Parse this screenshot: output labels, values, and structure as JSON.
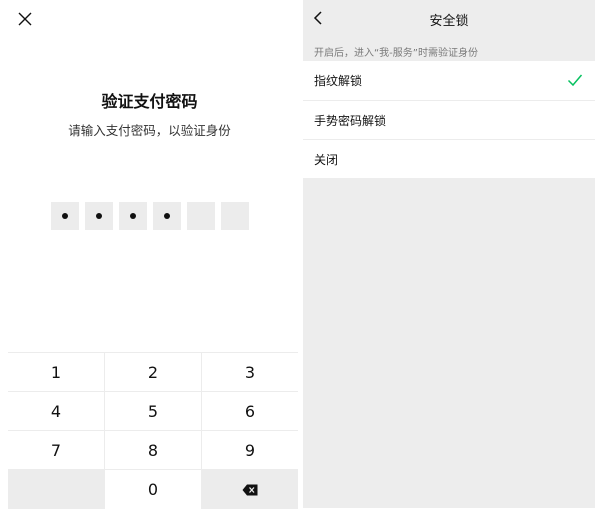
{
  "left": {
    "title": "验证支付密码",
    "subtitle": "请输入支付密码，以验证身份",
    "pin": {
      "length": 6,
      "filled_count": 4
    },
    "keypad": {
      "keys": [
        "1",
        "2",
        "3",
        "4",
        "5",
        "6",
        "7",
        "8",
        "9",
        "",
        "0",
        "backspace"
      ]
    },
    "icons": {
      "close": "close-icon",
      "backspace": "backspace-icon"
    }
  },
  "right": {
    "nav_title": "安全锁",
    "section_hint": "开启后，进入“我-服务”时需验证身份",
    "options": [
      {
        "label": "指纹解锁",
        "selected": true
      },
      {
        "label": "手势密码解锁",
        "selected": false
      },
      {
        "label": "关闭",
        "selected": false
      }
    ],
    "icons": {
      "back": "chevron-left-icon",
      "check": "check-icon"
    },
    "colors": {
      "accent_check": "#07c160",
      "background": "#ededed"
    }
  }
}
